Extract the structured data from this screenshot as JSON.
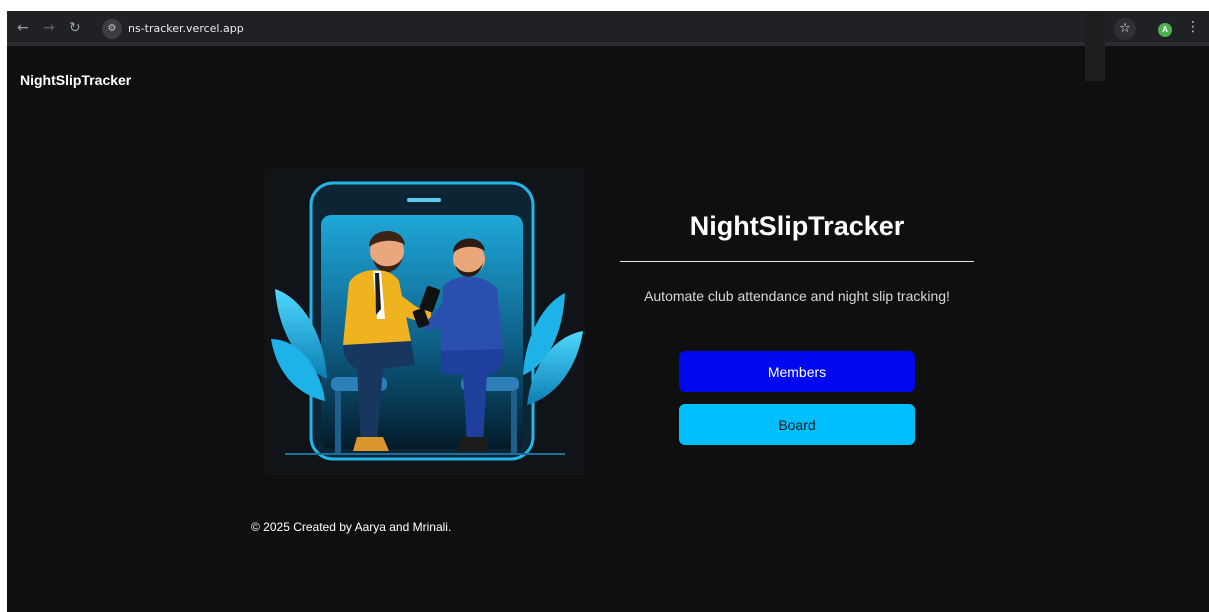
{
  "browser": {
    "url": "ns-tracker.vercel.app",
    "nav_icons": [
      "back-arrow-icon",
      "forward-arrow-icon",
      "reload-icon"
    ],
    "site_icon": "site-settings-icon",
    "bookmark_icon": "star-icon",
    "profile_initial": "A",
    "menu_icon": "kebab-menu-icon"
  },
  "header": {
    "brand": "NightSlipTracker"
  },
  "hero": {
    "title": "NightSlipTracker",
    "tagline": "Automate club attendance and night slip tracking!",
    "illustration": "two men sitting with phones in front of a large phone screen"
  },
  "buttons": {
    "members": "Members",
    "board": "Board"
  },
  "footer": {
    "text": "© 2025 Created by Aarya and Mrinali."
  },
  "colors": {
    "page_background": "#0f0f0f",
    "members_button": "#0008f0",
    "board_button": "#00bfff",
    "accent_cyan": "#22b6e6"
  }
}
